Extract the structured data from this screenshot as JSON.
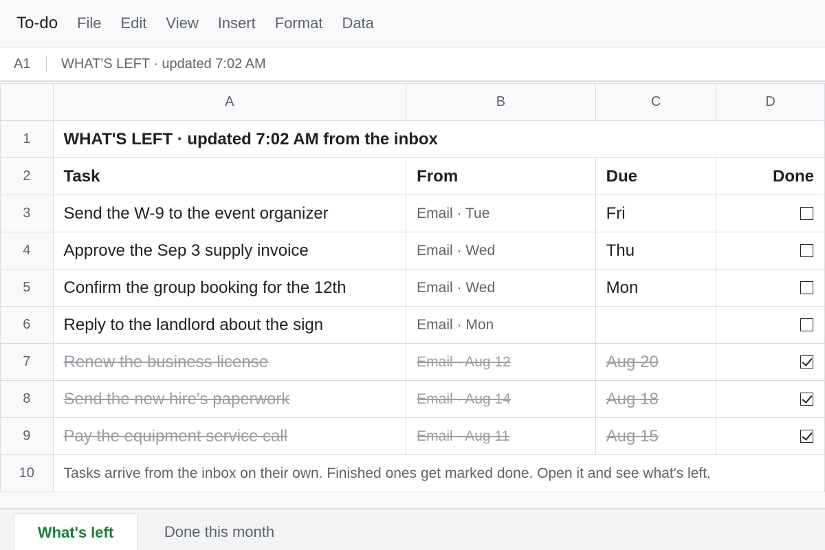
{
  "app": {
    "title": "To-do"
  },
  "menu": [
    "File",
    "Edit",
    "View",
    "Insert",
    "Format",
    "Data"
  ],
  "formula_bar": {
    "cell_ref": "A1",
    "content": "WHAT'S LEFT · updated 7:02 AM"
  },
  "columns": [
    "A",
    "B",
    "C",
    "D"
  ],
  "row_numbers": [
    "1",
    "2",
    "3",
    "4",
    "5",
    "6",
    "7",
    "8",
    "9",
    "10"
  ],
  "sheet": {
    "title": "WHAT'S LEFT · updated 7:02 AM from the inbox",
    "headers": {
      "task": "Task",
      "from": "From",
      "due": "Due",
      "done": "Done"
    },
    "tasks": [
      {
        "task": "Send the W-9 to the event organizer",
        "from": "Email · Tue",
        "due": "Fri",
        "done": false
      },
      {
        "task": "Approve the Sep 3 supply invoice",
        "from": "Email · Wed",
        "due": "Thu",
        "done": false
      },
      {
        "task": "Confirm the group booking for the 12th",
        "from": "Email · Wed",
        "due": "Mon",
        "done": false
      },
      {
        "task": "Reply to the landlord about the sign",
        "from": "Email · Mon",
        "due": "",
        "done": false
      },
      {
        "task": "Renew the business license",
        "from": "Email · Aug 12",
        "due": "Aug 20",
        "done": true
      },
      {
        "task": "Send the new hire's paperwork",
        "from": "Email · Aug 14",
        "due": "Aug 18",
        "done": true
      },
      {
        "task": "Pay the equipment service call",
        "from": "Email · Aug 11",
        "due": "Aug 15",
        "done": true
      }
    ],
    "note": "Tasks arrive from the inbox on their own. Finished ones get marked done. Open it and see what's left."
  },
  "tabs": [
    {
      "label": "What's left",
      "active": true
    },
    {
      "label": "Done this month",
      "active": false
    }
  ]
}
